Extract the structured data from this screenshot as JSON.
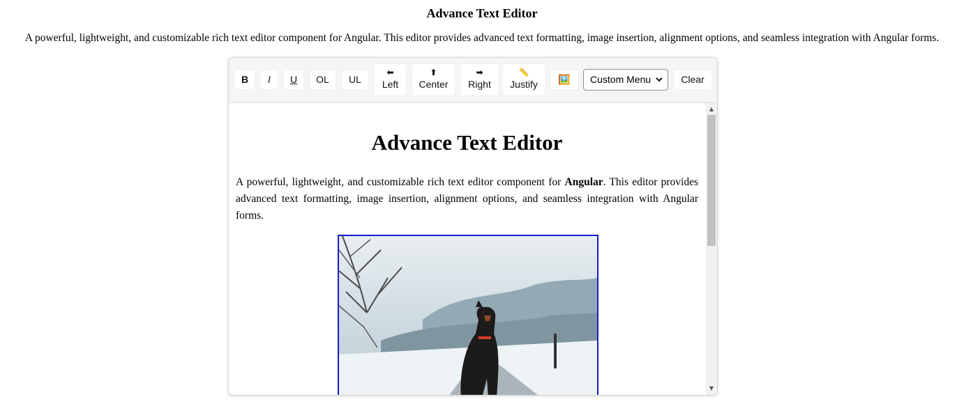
{
  "page": {
    "title": "Advance Text Editor",
    "description": "A powerful, lightweight, and customizable rich text editor component for Angular. This editor provides advanced text formatting, image insertion, alignment options, and seamless integration with Angular forms."
  },
  "toolbar": {
    "bold": "B",
    "italic": "I",
    "underline": "U",
    "ordered_list": "OL",
    "unordered_list": "UL",
    "align_left": {
      "glyph": "⬅",
      "label": "Left"
    },
    "align_center": {
      "glyph": "⬆",
      "label": "Center"
    },
    "align_right": {
      "glyph": "➡",
      "label": "Right"
    },
    "justify": {
      "glyph": "📏",
      "label": "Justify"
    },
    "image_icon": "🖼️",
    "custom_menu": {
      "selected": "Custom Menu"
    },
    "clear": "Clear"
  },
  "content": {
    "heading": "Advance Text Editor",
    "para_before": "A powerful, lightweight, and customizable rich text editor component for ",
    "para_bold": "Angular",
    "para_after": ". This editor provides advanced text formatting, image insertion, alignment options, and seamless integration with Angular forms."
  },
  "scroll": {
    "up_icon": "▲",
    "down_icon": "▼"
  },
  "colors": {
    "image_border": "#1a1acc",
    "toolbar_bg": "#f5f5f5",
    "scroll_thumb": "#c1c1c1"
  }
}
